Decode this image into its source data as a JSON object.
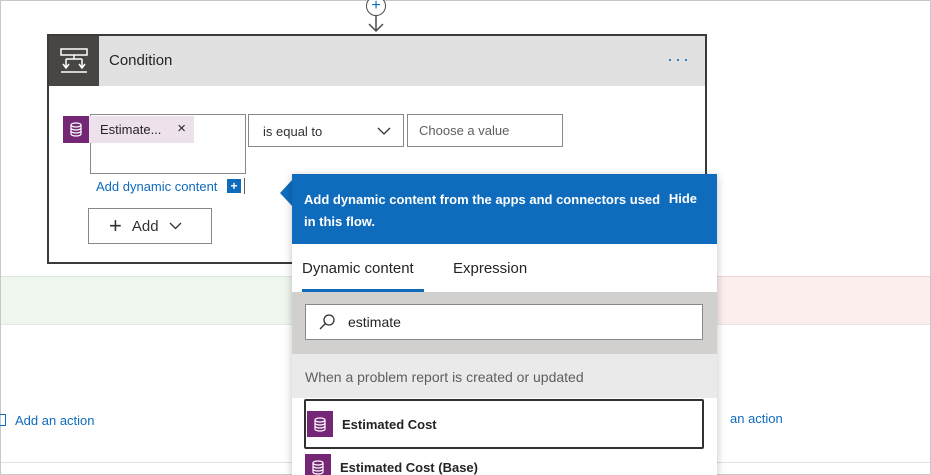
{
  "condition": {
    "title": "Condition",
    "more_label": "···",
    "token_label": "Estimate...",
    "token_remove": "×",
    "operator": "is equal to",
    "value_placeholder": "Choose a value",
    "add_dynamic_label": "Add dynamic content",
    "add_dynamic_plus": "+",
    "add_button_label": "Add"
  },
  "connector": {
    "plus": "+"
  },
  "flyout": {
    "header_text": "Add dynamic content from the apps and connectors used in this flow.",
    "hide_label": "Hide",
    "tabs": [
      "Dynamic content",
      "Expression"
    ],
    "search_value": "estimate",
    "section_title": "When a problem report is created or updated",
    "items": [
      {
        "label": "Estimated Cost",
        "selected": true
      },
      {
        "label": "Estimated Cost (Base)",
        "selected": false
      }
    ]
  },
  "canvas": {
    "add_action_left": "Add an action",
    "add_action_right": "an action"
  },
  "colors": {
    "accent": "#0f6cbd",
    "token_purple": "#742774",
    "token_bg": "#ede1ec",
    "header_gray": "#e1e1e1",
    "icon_dark": "#484644"
  },
  "icons": {
    "condition": "condition-icon",
    "token": "database-icon",
    "search": "search-icon",
    "chevron": "chevron-down-icon"
  }
}
